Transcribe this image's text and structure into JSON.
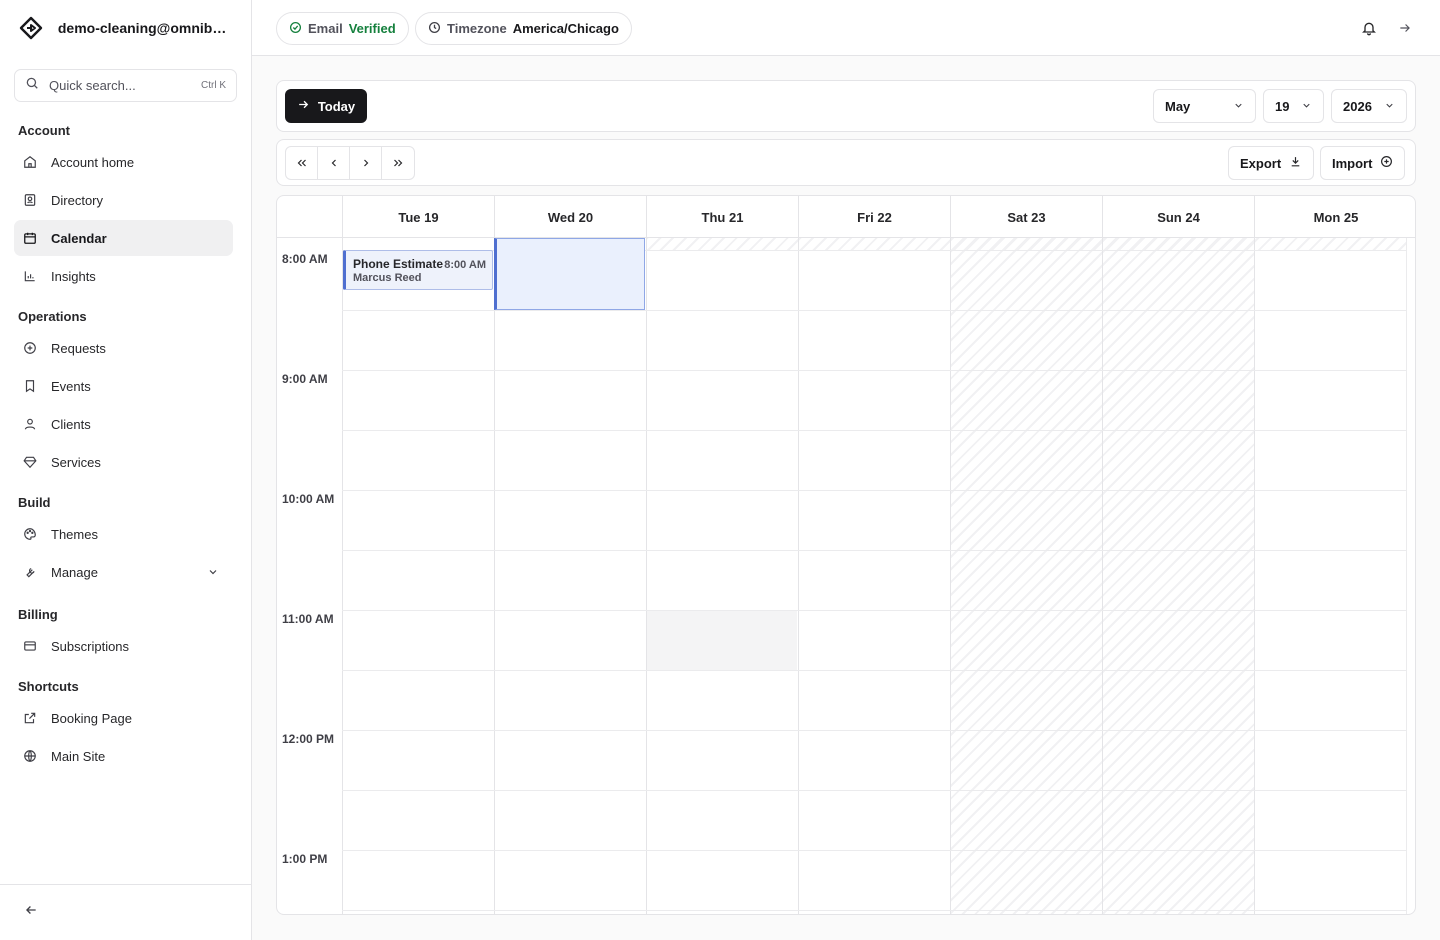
{
  "sidebar": {
    "account_email": "demo-cleaning@omnibooki...",
    "search": {
      "placeholder": "Quick search...",
      "shortcut": "Ctrl K"
    },
    "groups": [
      {
        "title": "Account",
        "items": [
          {
            "label": "Account home",
            "icon": "home-icon"
          },
          {
            "label": "Directory",
            "icon": "directory-icon"
          },
          {
            "label": "Calendar",
            "icon": "calendar-icon",
            "active": true
          },
          {
            "label": "Insights",
            "icon": "bar-chart-icon"
          }
        ]
      },
      {
        "title": "Operations",
        "items": [
          {
            "label": "Requests",
            "icon": "plus-circle-icon"
          },
          {
            "label": "Events",
            "icon": "bookmark-icon"
          },
          {
            "label": "Clients",
            "icon": "user-icon"
          },
          {
            "label": "Services",
            "icon": "gem-icon"
          }
        ]
      },
      {
        "title": "Build",
        "items": [
          {
            "label": "Themes",
            "icon": "palette-icon"
          },
          {
            "label": "Manage",
            "icon": "wrench-icon",
            "has_chevron": true
          }
        ]
      },
      {
        "title": "Billing",
        "items": [
          {
            "label": "Subscriptions",
            "icon": "card-icon"
          }
        ]
      },
      {
        "title": "Shortcuts",
        "items": [
          {
            "label": "Booking Page",
            "icon": "external-link-icon"
          },
          {
            "label": "Main Site",
            "icon": "globe-icon"
          }
        ]
      }
    ]
  },
  "topbar": {
    "email_label": "Email",
    "email_status": "Verified",
    "timezone_label": "Timezone",
    "timezone_value": "America/Chicago"
  },
  "toolbar": {
    "today_label": "Today",
    "month": "May",
    "day": "19",
    "year": "2026",
    "export_label": "Export",
    "import_label": "Import"
  },
  "calendar": {
    "days": [
      "Tue 19",
      "Wed 20",
      "Thu 21",
      "Fri 22",
      "Sat 23",
      "Sun 24",
      "Mon 25"
    ],
    "times": [
      "8:00 AM",
      "9:00 AM",
      "10:00 AM",
      "11:00 AM",
      "12:00 PM",
      "1:00 PM"
    ],
    "events": [
      {
        "title": "Phone Estimate",
        "time": "8:00 AM",
        "client": "Marcus Reed",
        "day": "Tue 19"
      }
    ]
  },
  "colors": {
    "accent": "#4f6fd0",
    "verified_green": "#15803d",
    "today_button": "#18181b"
  }
}
